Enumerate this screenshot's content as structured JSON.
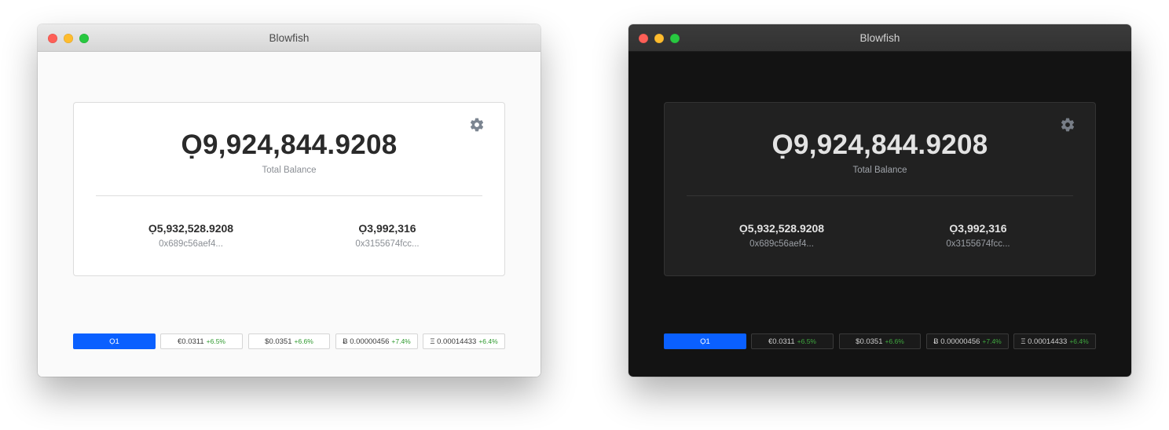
{
  "windows": [
    {
      "theme": "light",
      "title": "Blowfish",
      "total_balance": "Ọ9,924,844.9208",
      "total_label": "Total Balance",
      "wallets": [
        {
          "amount": "Ọ5,932,528.9208",
          "address": "0x689c56aef4..."
        },
        {
          "amount": "Ọ3,992,316",
          "address": "0x3155674fcc..."
        }
      ],
      "rates": [
        {
          "value": "Ọ1",
          "change": "",
          "active": true
        },
        {
          "value": "€0.0311",
          "change": "+6.5%"
        },
        {
          "value": "$0.0351",
          "change": "+6.6%"
        },
        {
          "value": "Ƀ 0.00000456",
          "change": "+7.4%"
        },
        {
          "value": "Ξ 0.00014433",
          "change": "+6.4%"
        }
      ]
    },
    {
      "theme": "dark",
      "title": "Blowfish",
      "total_balance": "Ọ9,924,844.9208",
      "total_label": "Total Balance",
      "wallets": [
        {
          "amount": "Ọ5,932,528.9208",
          "address": "0x689c56aef4..."
        },
        {
          "amount": "Ọ3,992,316",
          "address": "0x3155674fcc..."
        }
      ],
      "rates": [
        {
          "value": "Ọ1",
          "change": "",
          "active": true
        },
        {
          "value": "€0.0311",
          "change": "+6.5%"
        },
        {
          "value": "$0.0351",
          "change": "+6.6%"
        },
        {
          "value": "Ƀ 0.00000456",
          "change": "+7.4%"
        },
        {
          "value": "Ξ 0.00014433",
          "change": "+6.4%"
        }
      ]
    }
  ],
  "icons": {
    "settings": "gear-icon"
  },
  "colors": {
    "accent": "#0a60ff",
    "positive_change": "#2f9a2f",
    "traffic_close": "#fe5f57",
    "traffic_minimize": "#febc2e",
    "traffic_zoom": "#28c840"
  }
}
